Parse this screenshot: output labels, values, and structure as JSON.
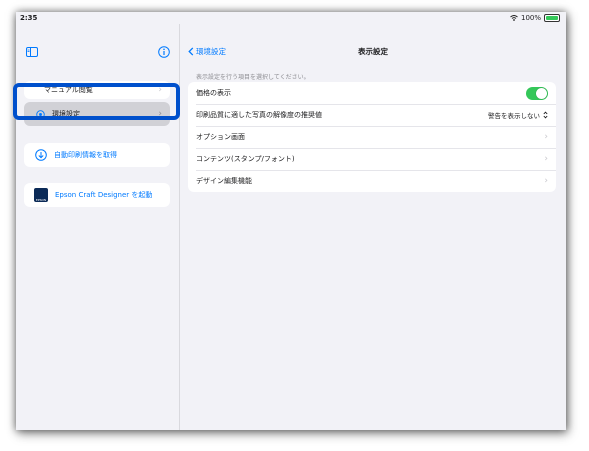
{
  "status_bar": {
    "time": "2:35",
    "battery": "100%"
  },
  "sidebar": {
    "partial_item_label": "マニュアル閲覧",
    "selected_item_label": "環境設定",
    "fetch_button_label": "自動印刷情報を取得",
    "launch_button_label": "Epson Craft Designer を起動",
    "app_icon_caption": "EPSON"
  },
  "main": {
    "back_label": "環境設定",
    "title": "表示設定",
    "section_header": "表示設定を行う項目を選択してください。",
    "rows": [
      {
        "label": "価格の表示",
        "toggle_on": true
      },
      {
        "label": "印刷品質に適した写真の解像度の推奨値",
        "value": "警告を表示しない"
      },
      {
        "label": "オプション画面"
      },
      {
        "label": "コンテンツ(スタンプ/フォント)"
      },
      {
        "label": "デザイン編集機能"
      }
    ]
  },
  "colors": {
    "accent": "#007aff",
    "toggle_on": "#34c759",
    "highlight": "#0050cc"
  }
}
